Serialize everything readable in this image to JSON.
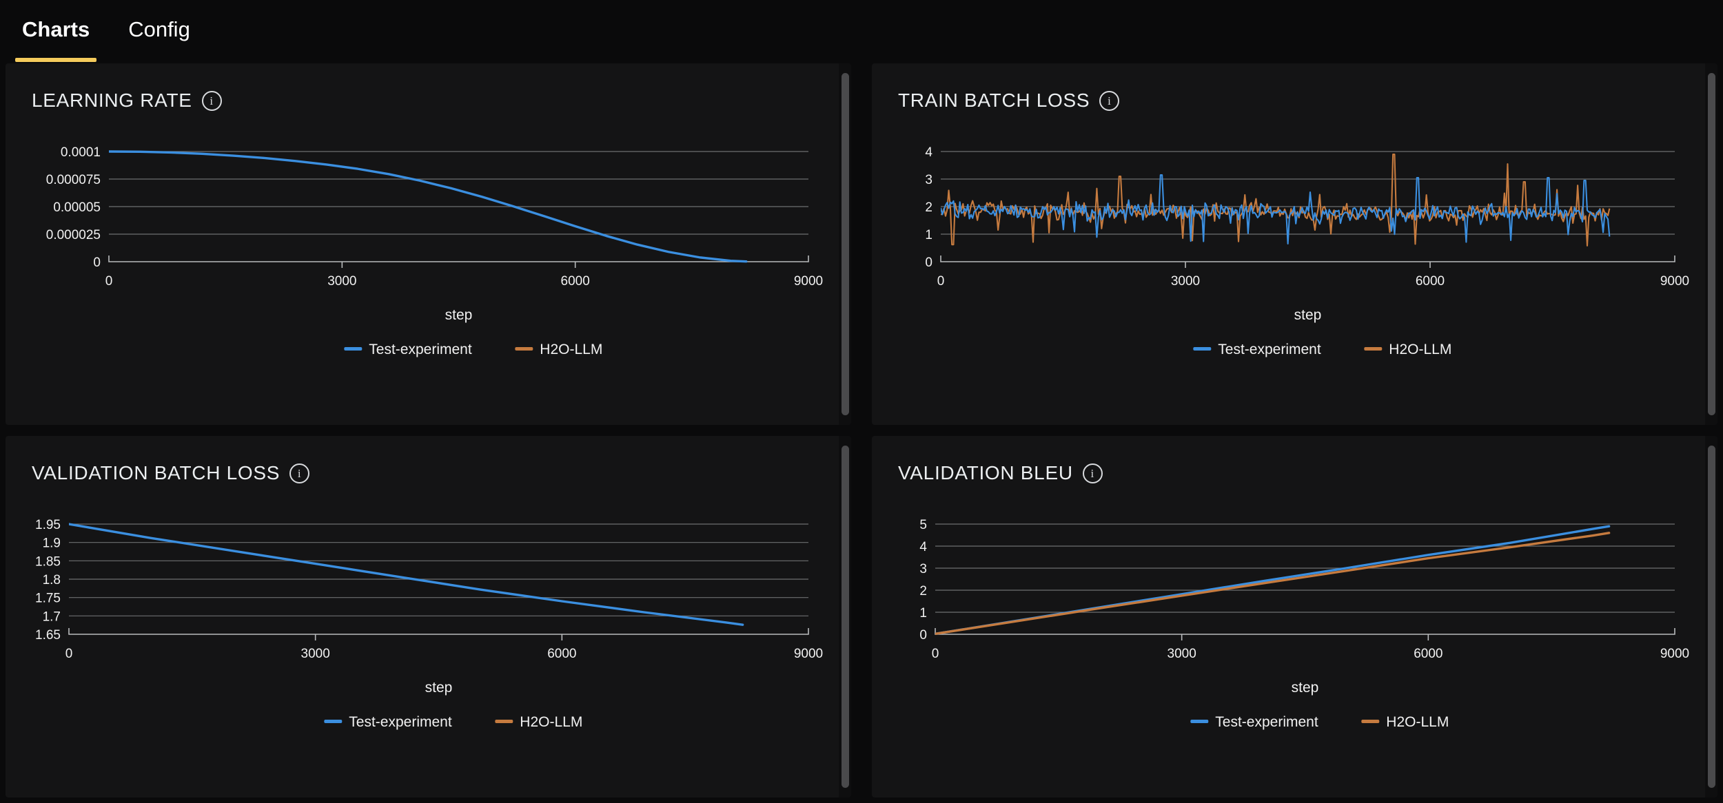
{
  "tabs": [
    {
      "label": "Charts",
      "active": true
    },
    {
      "label": "Config",
      "active": false
    }
  ],
  "colors": {
    "accent": "#f5cb5c",
    "series_blue": "#3b8fe0",
    "series_orange": "#c67b3f",
    "panel_bg": "#141415",
    "page_bg": "#0a0a0b",
    "grid": "#6d6f71",
    "text": "#f2f2f2"
  },
  "legend": {
    "entries": [
      {
        "label": "Test-experiment",
        "color": "#3b8fe0"
      },
      {
        "label": "H2O-LLM",
        "color": "#c67b3f"
      }
    ]
  },
  "info_icon": "i",
  "panels": [
    {
      "title": "LEARNING RATE",
      "info": "info-icon"
    },
    {
      "title": "TRAIN BATCH LOSS",
      "info": "info-icon"
    },
    {
      "title": "VALIDATION BATCH LOSS",
      "info": "info-icon"
    },
    {
      "title": "VALIDATION BLEU",
      "info": "info-icon"
    }
  ],
  "chart_data": [
    {
      "type": "line",
      "title": "LEARNING RATE",
      "xlabel": "step",
      "ylabel": "",
      "xlim": [
        0,
        9000
      ],
      "ylim": [
        0,
        0.0001
      ],
      "xticks": [
        0,
        3000,
        6000,
        9000
      ],
      "xticklabels": [
        "0",
        "3000",
        "6000",
        "9000"
      ],
      "yticks": [
        0,
        2.5e-05,
        5e-05,
        7.5e-05,
        0.0001
      ],
      "yticklabels": [
        "0",
        "0.000025",
        "0.00005",
        "0.000075",
        "0.0001"
      ],
      "grid": true,
      "legend_position": "bottom",
      "series": [
        {
          "name": "Test-experiment",
          "color": "#3b8fe0",
          "x": [
            0,
            400,
            800,
            1200,
            1600,
            2000,
            2400,
            2800,
            3200,
            3600,
            4000,
            4400,
            4800,
            5200,
            5600,
            6000,
            6400,
            6800,
            7200,
            7600,
            8000,
            8200
          ],
          "values": [
            0.0001,
            9.98e-05,
            9.91e-05,
            9.79e-05,
            9.62e-05,
            9.41e-05,
            9.14e-05,
            8.82e-05,
            8.43e-05,
            7.95e-05,
            7.36e-05,
            6.67e-05,
            5.89e-05,
            5.03e-05,
            4.13e-05,
            3.22e-05,
            2.34e-05,
            1.55e-05,
            8.9e-06,
            3.9e-06,
            8e-07,
            2e-07
          ]
        },
        {
          "name": "H2O-LLM",
          "color": "#c67b3f",
          "x": [],
          "values": []
        }
      ]
    },
    {
      "type": "line",
      "title": "TRAIN BATCH LOSS",
      "xlabel": "step",
      "ylabel": "",
      "xlim": [
        0,
        9000
      ],
      "ylim": [
        0,
        4
      ],
      "xticks": [
        0,
        3000,
        6000,
        9000
      ],
      "xticklabels": [
        "0",
        "3000",
        "6000",
        "9000"
      ],
      "yticks": [
        0,
        1,
        2,
        3,
        4
      ],
      "yticklabels": [
        "0",
        "1",
        "2",
        "3",
        "4"
      ],
      "grid": true,
      "legend_position": "bottom",
      "noise": true,
      "noise_spec": {
        "x_start": 0,
        "x_end": 8200,
        "n_points": 420,
        "mean_start": 1.85,
        "mean_end": 1.72,
        "amplitude": 0.45,
        "spikes_blue": [
          [
            2700,
            3.15
          ],
          [
            5850,
            3.05
          ],
          [
            7450,
            3.05
          ],
          [
            7900,
            2.95
          ]
        ],
        "spikes_orange": [
          [
            150,
            0.62
          ],
          [
            2200,
            3.1
          ],
          [
            5550,
            3.9
          ],
          [
            6950,
            3.55
          ],
          [
            7150,
            2.9
          ]
        ]
      },
      "series": [
        {
          "name": "Test-experiment",
          "color": "#3b8fe0",
          "range": [
            0.95,
            3.15
          ],
          "mean": 1.8
        },
        {
          "name": "H2O-LLM",
          "color": "#c67b3f",
          "range": [
            0.62,
            3.9
          ],
          "mean": 1.75
        }
      ]
    },
    {
      "type": "line",
      "title": "VALIDATION BATCH LOSS",
      "xlabel": "step",
      "ylabel": "",
      "xlim": [
        0,
        9000
      ],
      "ylim": [
        1.65,
        1.95
      ],
      "xticks": [
        0,
        3000,
        6000,
        9000
      ],
      "xticklabels": [
        "0",
        "3000",
        "6000",
        "9000"
      ],
      "yticks": [
        1.65,
        1.7,
        1.75,
        1.8,
        1.85,
        1.9,
        1.95
      ],
      "yticklabels": [
        "1.65",
        "1.7",
        "1.75",
        "1.8",
        "1.85",
        "1.9",
        "1.95"
      ],
      "grid": true,
      "legend_position": "bottom",
      "series": [
        {
          "name": "Test-experiment",
          "color": "#3b8fe0",
          "x": [
            0,
            1000,
            2000,
            3000,
            4000,
            5000,
            6000,
            7000,
            8000,
            8200
          ],
          "values": [
            1.95,
            1.912,
            1.877,
            1.842,
            1.807,
            1.772,
            1.74,
            1.71,
            1.682,
            1.676
          ]
        },
        {
          "name": "H2O-LLM",
          "color": "#c67b3f",
          "x": [],
          "values": []
        }
      ]
    },
    {
      "type": "line",
      "title": "VALIDATION BLEU",
      "xlabel": "step",
      "ylabel": "",
      "xlim": [
        0,
        9000
      ],
      "ylim": [
        0,
        5
      ],
      "xticks": [
        0,
        3000,
        6000,
        9000
      ],
      "xticklabels": [
        "0",
        "3000",
        "6000",
        "9000"
      ],
      "yticks": [
        0,
        1,
        2,
        3,
        4,
        5
      ],
      "yticklabels": [
        "0",
        "1",
        "2",
        "3",
        "4",
        "5"
      ],
      "grid": true,
      "legend_position": "bottom",
      "series": [
        {
          "name": "Test-experiment",
          "color": "#3b8fe0",
          "x": [
            0,
            1000,
            2000,
            3000,
            4000,
            5000,
            6000,
            7000,
            8000,
            8200
          ],
          "values": [
            0.02,
            0.62,
            1.22,
            1.82,
            2.42,
            3.0,
            3.6,
            4.15,
            4.78,
            4.9
          ]
        },
        {
          "name": "H2O-LLM",
          "color": "#c67b3f",
          "x": [
            0,
            1000,
            2000,
            3000,
            4000,
            5000,
            6000,
            7000,
            8000,
            8200
          ],
          "values": [
            0.02,
            0.6,
            1.18,
            1.75,
            2.32,
            2.88,
            3.45,
            3.95,
            4.48,
            4.6
          ]
        }
      ]
    }
  ]
}
